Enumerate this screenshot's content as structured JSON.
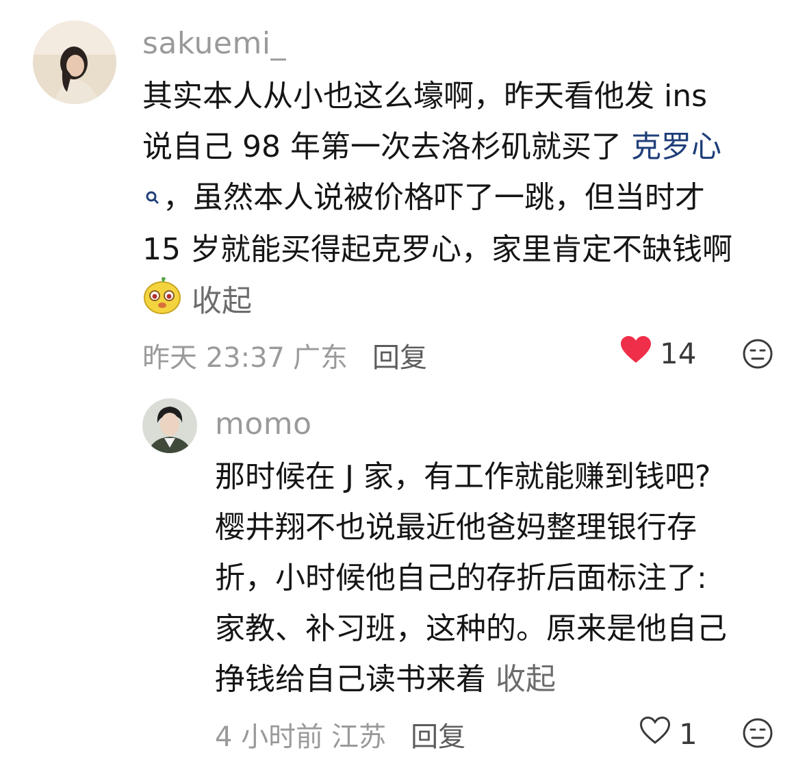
{
  "comments": [
    {
      "username": "sakuemi_",
      "lines": [
        "其实本人从小也这么壕啊，昨天看他发 ins",
        "说自己 98 年第一次去洛杉矶就买了 ",
        "，虽然本人说被价格吓了一跳，但当时才",
        "15 岁就能买得起克罗心，家里肯定不缺钱啊"
      ],
      "topic_link": "克罗心",
      "collapse_label": "收起",
      "time": "昨天 23:37",
      "location": "广东",
      "reply_label": "回复",
      "likes": "14",
      "liked": true
    },
    {
      "username": "momo",
      "lines": [
        "那时候在 J 家，有工作就能赚到钱吧?",
        "樱井翔不也说最近他爸妈整理银行存",
        "折，小时候他自己的存折后面标注了:",
        "家教、补习班，这种的。原来是他自己",
        "挣钱给自己读书来着 "
      ],
      "collapse_label": "收起",
      "time": "4 小时前",
      "location": "江苏",
      "reply_label": "回复",
      "likes": "1",
      "liked": false
    }
  ],
  "colors": {
    "like_active": "#ef2f4a",
    "topic_link": "#1f3f7a",
    "meta_text": "#9a9a9a"
  },
  "icons": [
    "heart-filled-icon",
    "heart-outline-icon",
    "dislike-face-icon",
    "search-icon",
    "emoji-face-icon"
  ]
}
